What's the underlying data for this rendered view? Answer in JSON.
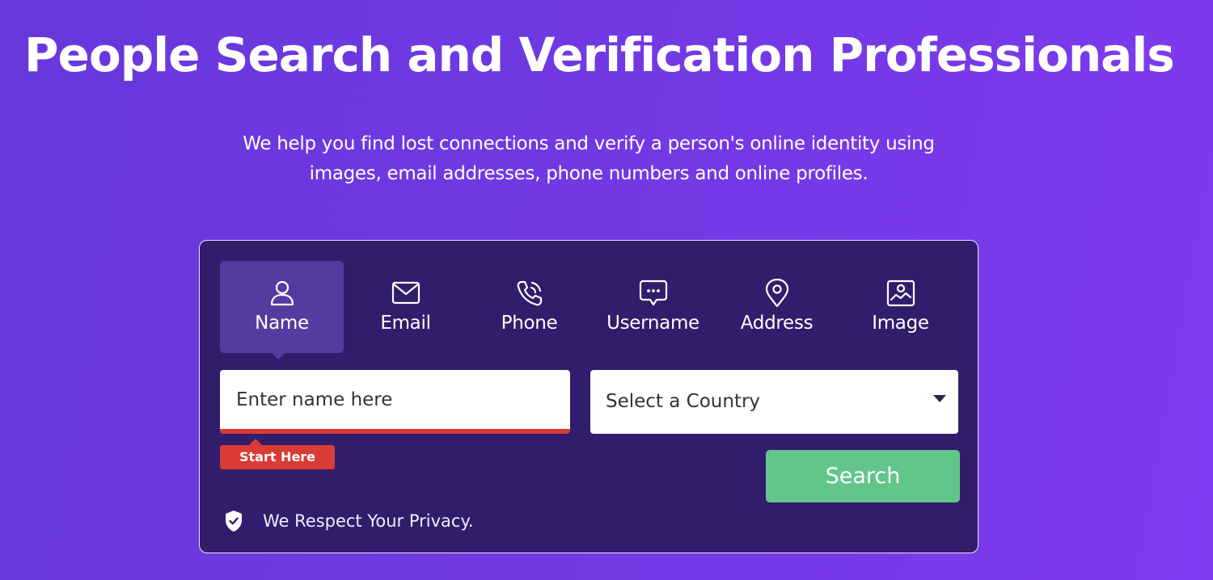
{
  "hero": {
    "title": "People Search and Verification Professionals",
    "subtitle_lines": [
      "We help you find lost connections and verify a person's online identity using",
      "images, email addresses, phone numbers and online profiles."
    ]
  },
  "search_card": {
    "tabs": [
      {
        "label": "Name",
        "icon": "user-icon",
        "active": true
      },
      {
        "label": "Email",
        "icon": "envelope-icon",
        "active": false
      },
      {
        "label": "Phone",
        "icon": "phone-icon",
        "active": false
      },
      {
        "label": "Username",
        "icon": "chat-bubble-icon",
        "active": false
      },
      {
        "label": "Address",
        "icon": "map-pin-icon",
        "active": false
      },
      {
        "label": "Image",
        "icon": "image-icon",
        "active": false
      }
    ],
    "name_input": {
      "placeholder": "Enter name here",
      "value": ""
    },
    "start_here_label": "Start Here",
    "country_select": {
      "selected": "Select a Country"
    },
    "search_button_label": "Search",
    "privacy_text": "We Respect Your Privacy."
  },
  "colors": {
    "background_start": "#6738db",
    "background_end": "#7f3aee",
    "card_bg": "#321c6c",
    "active_tab": "#553ba0",
    "accent_red": "#d93c35",
    "search_green": "#62c68b"
  }
}
